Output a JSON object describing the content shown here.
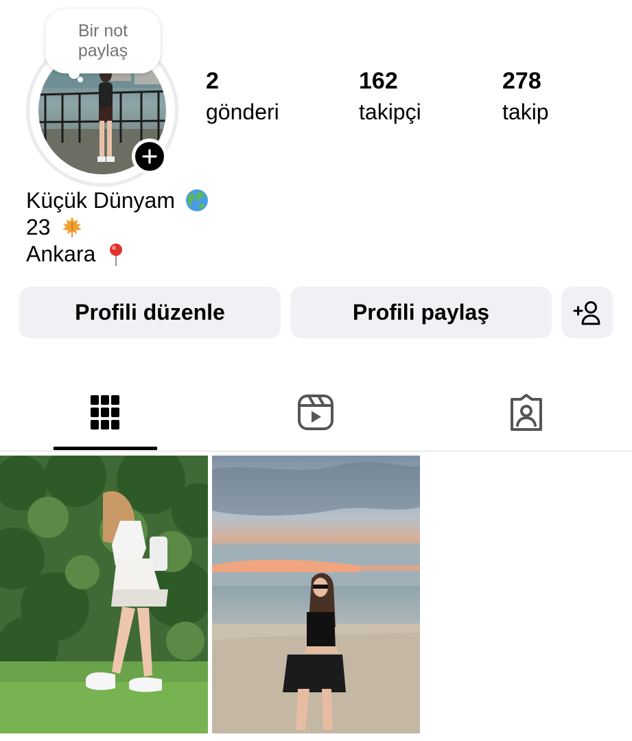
{
  "note": {
    "line1": "Bir not",
    "line2": "paylaş"
  },
  "stats": [
    {
      "value": "2",
      "label": "gönderi"
    },
    {
      "value": "162",
      "label": "takipçi"
    },
    {
      "value": "278",
      "label": "takip"
    }
  ],
  "bio": {
    "name": "Küçük Dünyam",
    "line2": "23",
    "line3": "Ankara",
    "name_emoji": "globe-emoji",
    "line2_emoji": "maple-leaf-emoji",
    "line3_emoji": "round-pushpin-emoji"
  },
  "buttons": {
    "edit": "Profili düzenle",
    "share": "Profili paylaş",
    "discover_icon": "add-person-icon"
  },
  "tabs": [
    {
      "icon": "grid-icon",
      "active": true
    },
    {
      "icon": "reels-icon",
      "active": false
    },
    {
      "icon": "tagged-icon",
      "active": false
    }
  ],
  "colors": {
    "button_bg": "#eff1f4",
    "accent": "#000000",
    "muted_text": "#737373",
    "divider": "#dbdbdb"
  }
}
